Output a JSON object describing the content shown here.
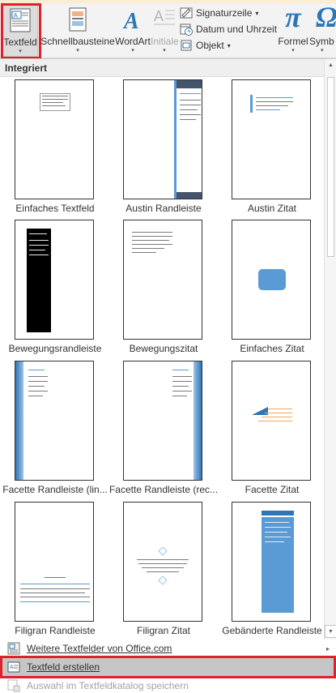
{
  "ribbon": {
    "buttons": [
      {
        "label": "Textfeld",
        "arrow": "▾"
      },
      {
        "label": "Schnellbausteine",
        "arrow": "▾"
      },
      {
        "label": "WordArt",
        "arrow": "▾"
      },
      {
        "label": "Initiale",
        "arrow": "▾"
      }
    ],
    "small_commands": [
      {
        "label": "Signaturzeile",
        "arrow": "▾",
        "icon": "signature-line-icon"
      },
      {
        "label": "Datum und Uhrzeit",
        "icon": "date-time-icon"
      },
      {
        "label": "Objekt",
        "arrow": "▾",
        "icon": "object-icon"
      }
    ],
    "formula": {
      "label": "Formel",
      "glyph": "π",
      "arrow": "▾"
    },
    "symbol": {
      "label": "Symb",
      "glyph": "Ω",
      "arrow": "▾"
    }
  },
  "gallery": {
    "group_header": "Integriert",
    "scroll_up": "▲",
    "scroll_down": "▼",
    "items": [
      {
        "label": "Einfaches Textfeld",
        "style": "simple-box"
      },
      {
        "label": "Austin Randleiste",
        "style": "austin-sidebar"
      },
      {
        "label": "Austin Zitat",
        "style": "austin-quote"
      },
      {
        "label": "Bewegungsrandleiste",
        "style": "motion-sidebar"
      },
      {
        "label": "Bewegungszitat",
        "style": "motion-quote"
      },
      {
        "label": "Einfaches Zitat",
        "style": "simple-quote"
      },
      {
        "label": "Facette Randleiste (lin...",
        "style": "facet-left"
      },
      {
        "label": "Facette Randleiste (rec...",
        "style": "facet-right"
      },
      {
        "label": "Facette Zitat",
        "style": "facet-quote"
      },
      {
        "label": "Filigran Randleiste",
        "style": "filigree-sidebar"
      },
      {
        "label": "Filigran Zitat",
        "style": "filigree-quote"
      },
      {
        "label": "Gebänderte Randleiste",
        "style": "banded-sidebar"
      }
    ]
  },
  "menu": [
    {
      "label": "Weitere Textfelder von Office.com",
      "icon": "office-textbox-icon",
      "state": "normal",
      "chevron": "▸"
    },
    {
      "label": "Textfeld erstellen",
      "icon": "draw-textbox-icon",
      "state": "highlighted"
    },
    {
      "label": "Auswahl im Textfeldkatalog speichern",
      "icon": "save-selection-icon",
      "state": "disabled"
    }
  ],
  "colors": {
    "highlight_frame": "#e0202a",
    "accent_blue": "#5b9bd5",
    "dark_navy": "#44546a",
    "wordart_blue": "#2e75b6"
  }
}
